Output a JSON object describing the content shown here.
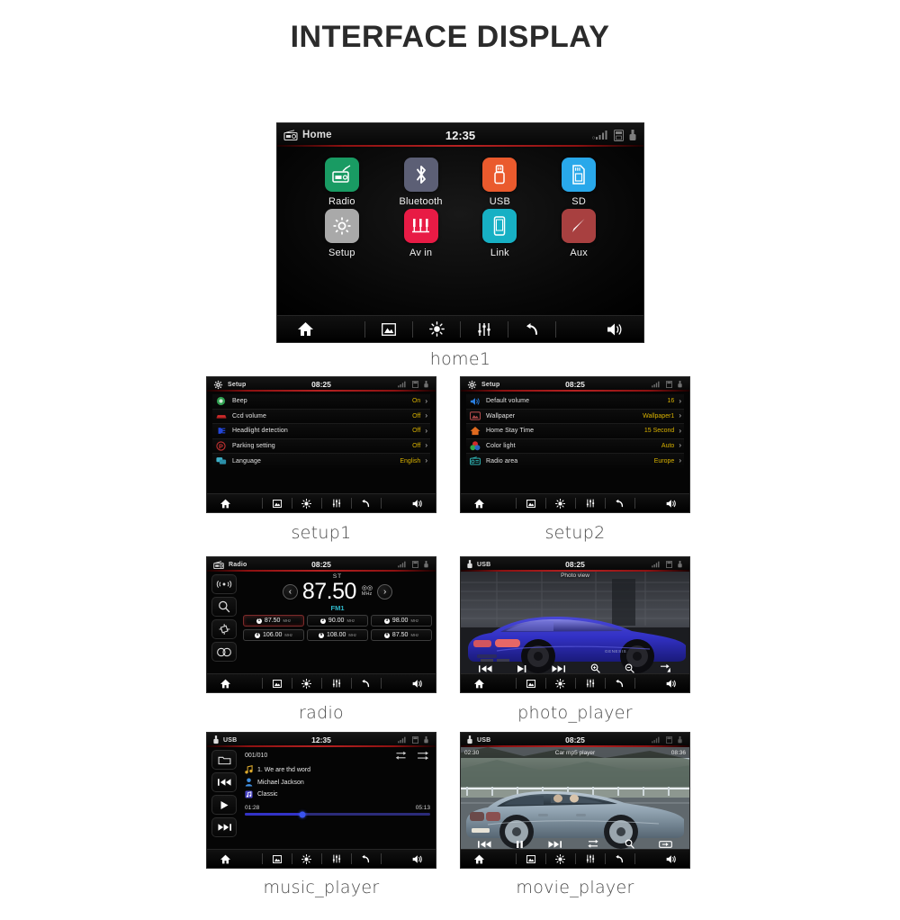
{
  "page": {
    "title": "INTERFACE DISPLAY",
    "background": "#ffffff"
  },
  "captions": {
    "home": "home1",
    "setup1": "setup1",
    "setup2": "setup2",
    "radio": "radio",
    "photo": "photo_player",
    "music": "music_player",
    "movie": "movie_player"
  },
  "statusbar_icons": {
    "signal": "signal-bars-icon",
    "card": "sd-card-icon",
    "usb": "usb-plug-icon"
  },
  "navbar": {
    "home": "home-icon",
    "picture": "picture-icon",
    "brightness": "brightness-icon",
    "equalizer": "equalizer-icon",
    "back": "back-arrow-icon",
    "volume": "volume-icon"
  },
  "home": {
    "status": {
      "source": "Home",
      "clock": "12:35",
      "source_icon": "radio-icon"
    },
    "apps": [
      {
        "label": "Radio",
        "icon": "radio-icon",
        "color": "#199b63"
      },
      {
        "label": "Bluetooth",
        "icon": "bluetooth-icon",
        "color": "#5c5f75"
      },
      {
        "label": "USB",
        "icon": "usb-icon",
        "color": "#ea5a2d"
      },
      {
        "label": "SD",
        "icon": "sd-card-icon",
        "color": "#29a8ea"
      },
      {
        "label": "Setup",
        "icon": "gear-icon",
        "color": "#a9a9a9"
      },
      {
        "label": "Av in",
        "icon": "av-in-icon",
        "color": "#e81b45"
      },
      {
        "label": "Link",
        "icon": "phone-link-icon",
        "color": "#17b0c4"
      },
      {
        "label": "Aux",
        "icon": "aux-plug-icon",
        "color": "#a84040"
      }
    ]
  },
  "setup1": {
    "status": {
      "source": "Setup",
      "clock": "08:25",
      "source_icon": "gear-icon"
    },
    "rows": [
      {
        "icon": "beep-icon",
        "icon_color": "#2f9e4f",
        "label": "Beep",
        "value": "On"
      },
      {
        "icon": "car-icon",
        "icon_color": "#d12b2b",
        "label": "Ccd volume",
        "value": "Off"
      },
      {
        "icon": "headlight-icon",
        "icon_color": "#2346d8",
        "label": "Headlight detection",
        "value": "Off"
      },
      {
        "icon": "parking-icon",
        "icon_color": "#c33232",
        "label": "Parking setting",
        "value": "Off"
      },
      {
        "icon": "language-icon",
        "icon_color": "#3fb2c9",
        "label": "Language",
        "value": "English"
      }
    ]
  },
  "setup2": {
    "status": {
      "source": "Setup",
      "clock": "08:25",
      "source_icon": "gear-icon"
    },
    "rows": [
      {
        "icon": "volume-icon",
        "icon_color": "#2a7fe0",
        "label": "Default volume",
        "value": "16"
      },
      {
        "icon": "wallpaper-icon",
        "icon_color": "#b04a4a",
        "label": "Wallpaper",
        "value": "Wallpaper1"
      },
      {
        "icon": "home-icon",
        "icon_color": "#e06a1f",
        "label": "Home Stay Time",
        "value": "15 Second"
      },
      {
        "icon": "color-light-icon",
        "icon_color": "#35b04a",
        "label": "Color light",
        "value": "Auto"
      },
      {
        "icon": "radio-icon",
        "icon_color": "#2fb3b3",
        "label": "Radio area",
        "value": "Europe"
      }
    ]
  },
  "radio": {
    "status": {
      "source": "Radio",
      "clock": "08:25",
      "source_icon": "radio-icon"
    },
    "side_buttons": [
      "antenna-icon",
      "search-icon",
      "scan-icon",
      "stereo-icon"
    ],
    "stereo_flag": "ST",
    "frequency": "87.50",
    "unit": "MHz",
    "band": "FM1",
    "prev_icon": "chevron-left-icon",
    "next_icon": "chevron-right-icon",
    "presets": [
      {
        "num": "1",
        "freq": "87.50",
        "unit": "MHz",
        "active": true
      },
      {
        "num": "2",
        "freq": "90.00",
        "unit": "MHz",
        "active": false
      },
      {
        "num": "3",
        "freq": "98.00",
        "unit": "MHz",
        "active": false
      },
      {
        "num": "4",
        "freq": "106.00",
        "unit": "MHz",
        "active": false
      },
      {
        "num": "5",
        "freq": "108.00",
        "unit": "MHz",
        "active": false
      },
      {
        "num": "6",
        "freq": "87.50",
        "unit": "MHz",
        "active": false
      }
    ]
  },
  "photo": {
    "status": {
      "source": "USB",
      "clock": "08:25",
      "source_icon": "usb-icon"
    },
    "view_title": "Photo view",
    "controls": [
      "prev-icon",
      "play-icon",
      "next-icon",
      "zoom-in-icon",
      "zoom-out-icon",
      "rotate-icon"
    ]
  },
  "music": {
    "status": {
      "source": "USB",
      "clock": "12:35",
      "source_icon": "usb-icon"
    },
    "side_buttons": [
      "folder-icon",
      "prev-track-icon",
      "play-icon",
      "next-track-icon"
    ],
    "track_index": "001/010",
    "mode_icons": [
      "repeat-icon",
      "shuffle-icon"
    ],
    "title": "1. We are thd word",
    "artist": "Michael Jackson",
    "genre": "Classic",
    "elapsed": "01:28",
    "duration": "05:13",
    "progress_percent": 31
  },
  "movie": {
    "status": {
      "source": "USB",
      "clock": "08:25",
      "source_icon": "usb-icon"
    },
    "elapsed": "02:30",
    "view_title": "Car mp5 player",
    "duration": "08:36",
    "controls": [
      "prev-icon",
      "pause-icon",
      "next-icon",
      "repeat-icon",
      "search-icon",
      "fullscreen-icon"
    ]
  },
  "colors": {
    "accent_red": "#b52222",
    "value_yellow": "#d8b100",
    "band_cyan": "#2fb7c9",
    "progress_blue": "#3333c7"
  }
}
